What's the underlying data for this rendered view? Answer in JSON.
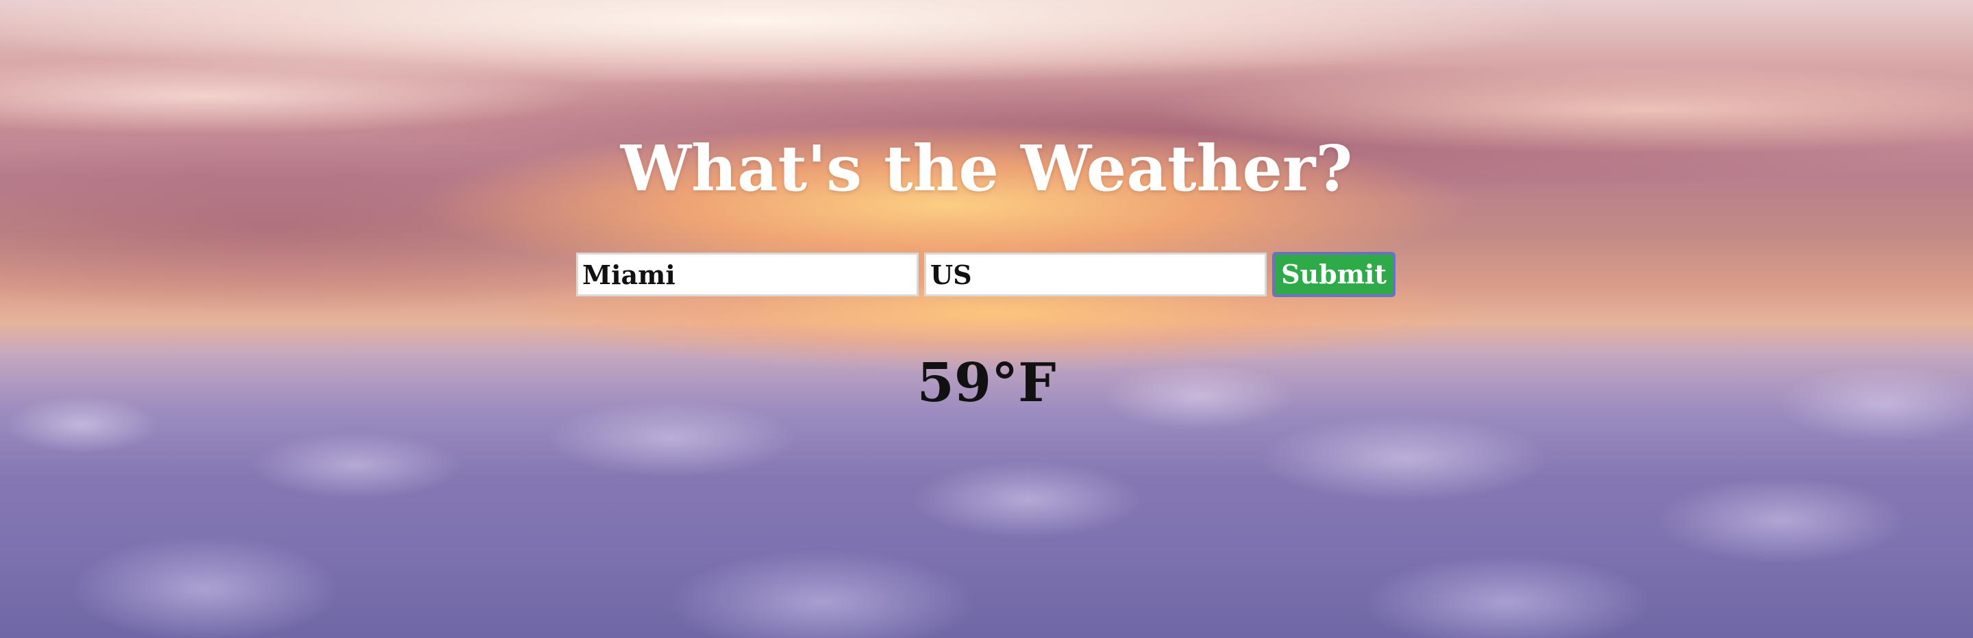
{
  "page": {
    "title": "What's the Weather?",
    "background_colors": {
      "sky_top": "#e8cfcf",
      "sunset_glow": "#ffd282",
      "clouds": "#8577b2"
    }
  },
  "form": {
    "city_value": "Miami",
    "country_value": "US",
    "submit_label": "Submit",
    "submit_color": "#2faa48",
    "focus_ring_color": "#6b72c4"
  },
  "result": {
    "temperature": "59°F"
  }
}
